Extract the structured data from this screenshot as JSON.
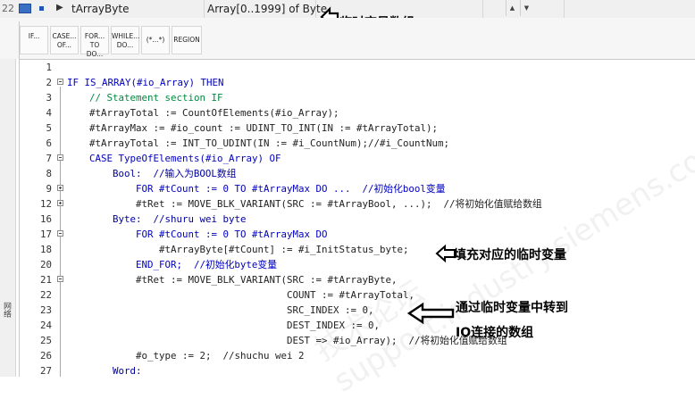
{
  "variable_row": {
    "row_number": "22",
    "name": "tArrayByte",
    "type": "Array[0..1999] of Byte"
  },
  "annotations": {
    "top": "临时变量数组",
    "fill": "填充对应的临时变量",
    "transfer_line1": "通过临时变量中转到",
    "transfer_line2": "IO连接的数组"
  },
  "toolbar": {
    "buttons": [
      {
        "name": "if",
        "label": "IF..."
      },
      {
        "name": "case",
        "label": "CASE... OF..."
      },
      {
        "name": "for",
        "label": "FOR... TO DO..."
      },
      {
        "name": "while",
        "label": "WHILE... DO..."
      },
      {
        "name": "comment",
        "label": "(*...*)"
      },
      {
        "name": "region",
        "label": "REGION"
      }
    ]
  },
  "left_panel": {
    "label": "网络"
  },
  "watermark": "技术论坛 support.industry.siemens.com/cs",
  "code_lines": [
    {
      "n": "1",
      "t": ""
    },
    {
      "n": "2",
      "t": "IF IS_ARRAY(#io_Array) THEN"
    },
    {
      "n": "3",
      "t": "    // Statement section IF"
    },
    {
      "n": "4",
      "t": "    #tArrayTotal := CountOfElements(#io_Array);"
    },
    {
      "n": "5",
      "t": "    #tArrayMax := #io_count := UDINT_TO_INT(IN := #tArrayTotal);"
    },
    {
      "n": "6",
      "t": "    #tArrayTotal := INT_TO_UDINT(IN := #i_CountNum);//#i_CountNum;"
    },
    {
      "n": "7",
      "t": "    CASE TypeOfElements(#io_Array) OF"
    },
    {
      "n": "8",
      "t": "        Bool:  //输入为BOOL数组"
    },
    {
      "n": "9",
      "t": "            FOR #tCount := 0 TO #tArrayMax DO ...  //初始化bool变量"
    },
    {
      "n": "12",
      "t": "            #tRet := MOVE_BLK_VARIANT(SRC := #tArrayBool, ...);  //将初始化值赋给数组"
    },
    {
      "n": "16",
      "t": "        Byte:  //shuru wei byte"
    },
    {
      "n": "17",
      "t": "            FOR #tCount := 0 TO #tArrayMax DO"
    },
    {
      "n": "18",
      "t": "                #tArrayByte[#tCount] := #i_InitStatus_byte;"
    },
    {
      "n": "20",
      "t": "            END_FOR;  //初始化byte变量"
    },
    {
      "n": "21",
      "t": "            #tRet := MOVE_BLK_VARIANT(SRC := #tArrayByte,"
    },
    {
      "n": "22",
      "t": "                                      COUNT := #tArrayTotal,"
    },
    {
      "n": "23",
      "t": "                                      SRC_INDEX := 0,"
    },
    {
      "n": "24",
      "t": "                                      DEST_INDEX := 0,"
    },
    {
      "n": "25",
      "t": "                                      DEST => #io_Array);  //将初始化值赋给数组"
    },
    {
      "n": "26",
      "t": "            #o_type := 2;  //shuchu wei 2"
    },
    {
      "n": "27",
      "t": "        Word:"
    }
  ]
}
